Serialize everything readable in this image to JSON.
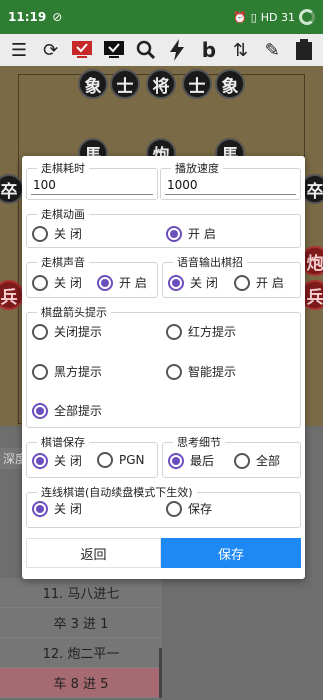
{
  "status": {
    "time": "11:19",
    "right": "HD 31"
  },
  "toolbar": {
    "b_label": "b"
  },
  "board": {
    "top_pieces": [
      "象",
      "士",
      "将",
      "士",
      "象"
    ],
    "row2": [
      "馬",
      "炮",
      "馬"
    ],
    "side_left": "卒",
    "side_right": "卒",
    "red_left": "兵",
    "red_right_top": "炮",
    "red_right_bottom": "兵"
  },
  "dialog": {
    "move_time": {
      "label": "走棋耗时",
      "value": "100"
    },
    "play_speed": {
      "label": "播放速度",
      "value": "1000"
    },
    "animation": {
      "label": "走棋动画",
      "options": [
        "关 闭",
        "开 启"
      ],
      "selected": 1
    },
    "sound": {
      "label": "走棋声音",
      "options": [
        "关 闭",
        "开 启"
      ],
      "selected": 1
    },
    "voice": {
      "label": "语音输出棋招",
      "options": [
        "关 闭",
        "开 启"
      ],
      "selected": 0
    },
    "arrow": {
      "label": "棋盘箭头提示",
      "options": [
        "关闭提示",
        "红方提示",
        "黑方提示",
        "智能提示",
        "全部提示"
      ],
      "selected": 4
    },
    "save": {
      "label": "棋谱保存",
      "options": [
        "关 闭",
        "PGN"
      ],
      "selected": 0
    },
    "detail": {
      "label": "思考细节",
      "options": [
        "最后",
        "全部"
      ],
      "selected": 0
    },
    "online": {
      "label": "连线棋谱(自动续盘模式下生效)",
      "options": [
        "关 闭",
        "保存"
      ],
      "selected": 0
    },
    "back_label": "返回",
    "save_label": "保存"
  },
  "lower": {
    "depth_label": "深度",
    "moves": [
      "11. 马八进七",
      "卒 3 进 1",
      "12. 炮二平一",
      "车 8 进 5"
    ]
  }
}
